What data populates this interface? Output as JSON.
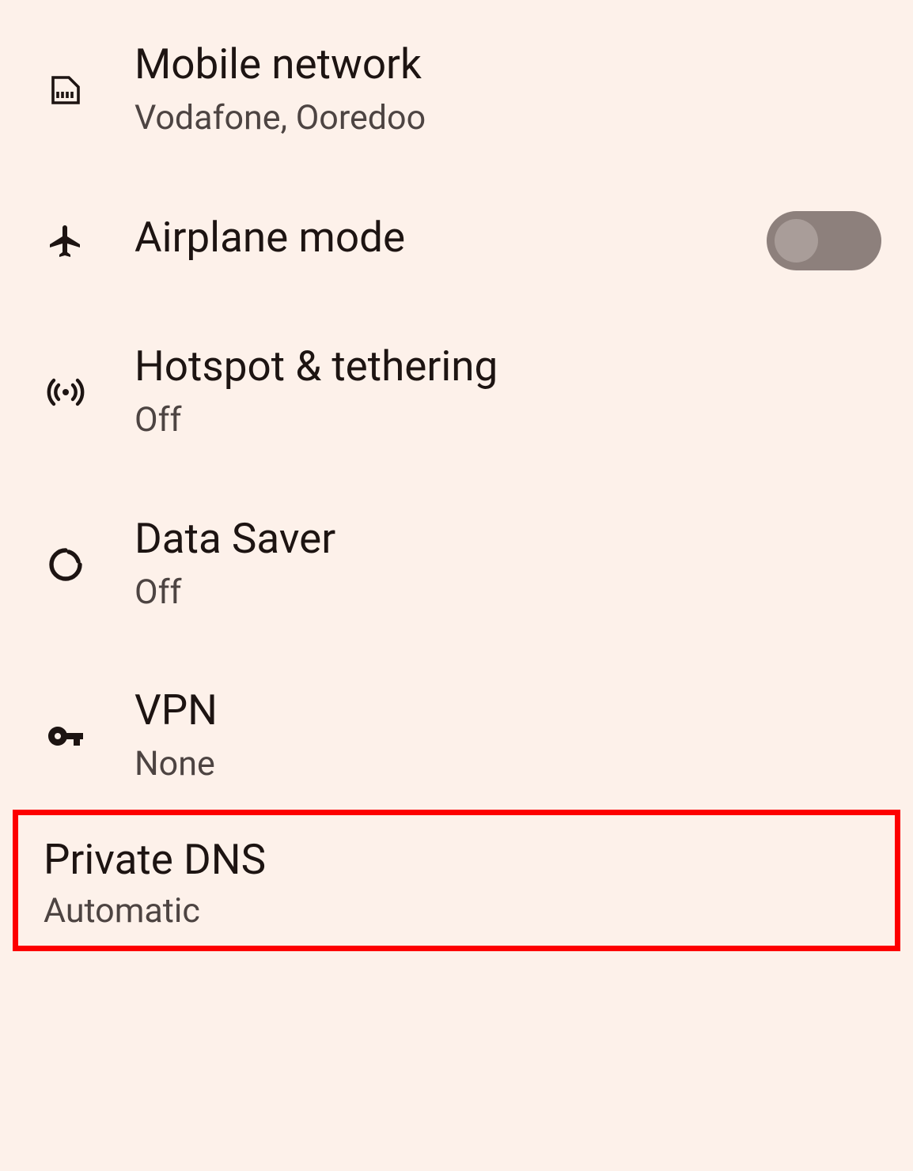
{
  "items": {
    "mobile_network": {
      "title": "Mobile network",
      "subtitle": "Vodafone, Ooredoo"
    },
    "airplane_mode": {
      "title": "Airplane mode",
      "enabled": false
    },
    "hotspot": {
      "title": "Hotspot & tethering",
      "subtitle": "Off"
    },
    "data_saver": {
      "title": "Data Saver",
      "subtitle": "Off"
    },
    "vpn": {
      "title": "VPN",
      "subtitle": "None"
    },
    "private_dns": {
      "title": "Private DNS",
      "subtitle": "Automatic"
    }
  }
}
